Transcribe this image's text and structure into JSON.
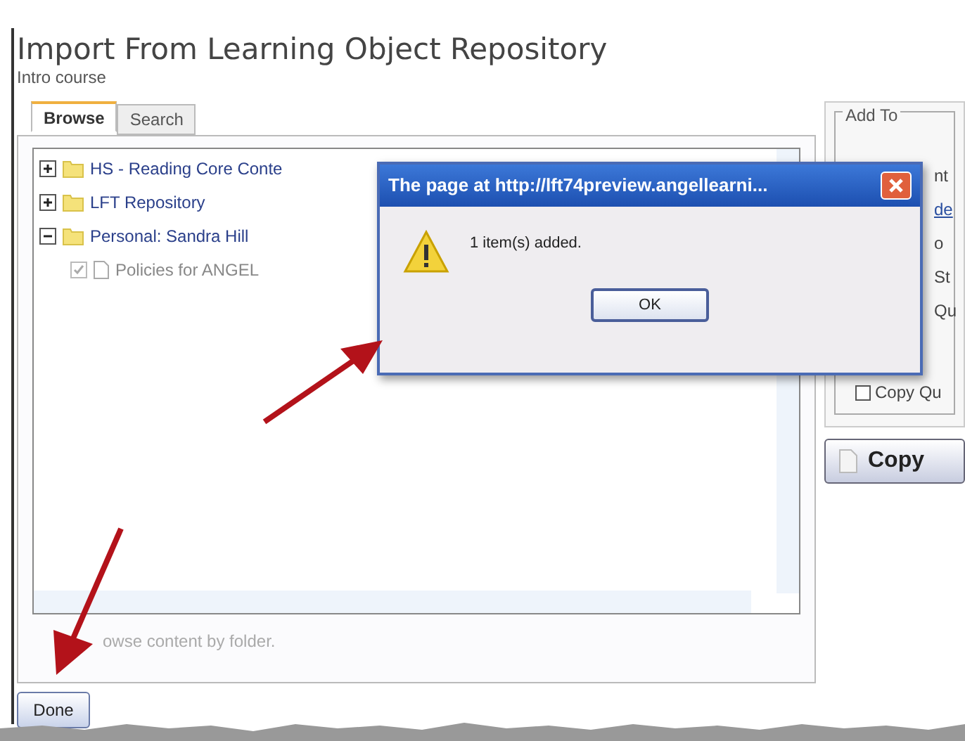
{
  "header": {
    "title": "Import From Learning Object Repository",
    "subtitle": "Intro course"
  },
  "tabs": [
    {
      "label": "Browse",
      "selected": true
    },
    {
      "label": "Search",
      "selected": false
    }
  ],
  "tree": [
    {
      "label": "HS - Reading Core Conte",
      "expanded": false,
      "kind": "folder"
    },
    {
      "label": "LFT Repository",
      "expanded": false,
      "kind": "folder"
    },
    {
      "label": "Personal: Sandra Hill",
      "expanded": true,
      "kind": "folder",
      "children": [
        {
          "label": "Policies for ANGEL",
          "kind": "page",
          "checked": true,
          "disabled": true
        }
      ]
    }
  ],
  "hint": "owse content by folder.",
  "add_to": {
    "legend": "Add To",
    "fragments": [
      "nt",
      "de",
      "o",
      "St",
      "Qu"
    ],
    "checkbox": {
      "label": "Copy Qu",
      "checked": false
    },
    "copy_button": "Copy"
  },
  "done_button": "Done",
  "alert": {
    "title": "The page at http://lft74preview.angellearni...",
    "message": "1 item(s) added.",
    "ok": "OK"
  }
}
